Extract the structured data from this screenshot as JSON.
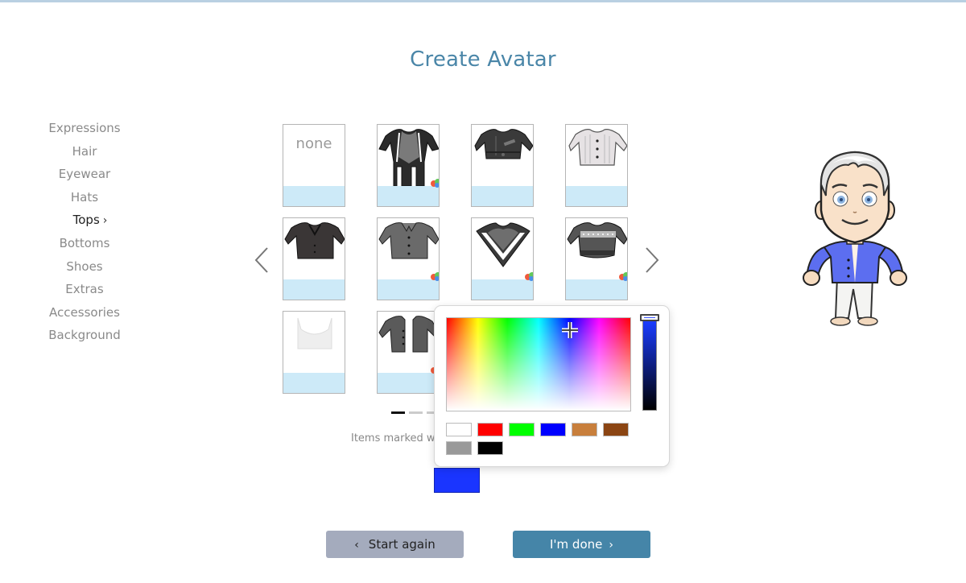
{
  "page": {
    "title": "Create Avatar"
  },
  "sidebar": {
    "items": [
      {
        "label": "Expressions",
        "active": false
      },
      {
        "label": "Hair",
        "active": false
      },
      {
        "label": "Eyewear",
        "active": false
      },
      {
        "label": "Hats",
        "active": false
      },
      {
        "label": "Tops",
        "active": true
      },
      {
        "label": "Bottoms",
        "active": false
      },
      {
        "label": "Shoes",
        "active": false
      },
      {
        "label": "Extras",
        "active": false
      },
      {
        "label": "Accessories",
        "active": false
      },
      {
        "label": "Background",
        "active": false
      }
    ],
    "active_chevron": "›"
  },
  "gallery": {
    "items": [
      {
        "name": "none",
        "label": "none",
        "colorable": false
      },
      {
        "name": "biker-jacket",
        "colorable": true
      },
      {
        "name": "cropped-jacket",
        "colorable": false
      },
      {
        "name": "striped-shirt",
        "colorable": false
      },
      {
        "name": "tuxedo-jacket",
        "colorable": false
      },
      {
        "name": "button-shirt",
        "colorable": true
      },
      {
        "name": "v-neck-collar",
        "colorable": true
      },
      {
        "name": "patterned-sweater",
        "colorable": true
      },
      {
        "name": "lace-crop-top",
        "colorable": false
      },
      {
        "name": "open-shirt",
        "colorable": true
      }
    ],
    "prev_icon": "chevron-left-icon",
    "next_icon": "chevron-right-icon",
    "pages": 3,
    "current_page": 1,
    "note": "Items marked w"
  },
  "color_picker": {
    "selected_color": "#1a35ff",
    "swatches": [
      "#ffffff",
      "#ff0000",
      "#00ff00",
      "#0000ff",
      "#c87f3c",
      "#8b4513",
      "#999999",
      "#000000"
    ]
  },
  "avatar": {
    "top_color": "#5c6ef0"
  },
  "actions": {
    "start_again_label": "Start again",
    "done_label": "I'm done",
    "start_chevron": "‹",
    "done_chevron": "›"
  }
}
